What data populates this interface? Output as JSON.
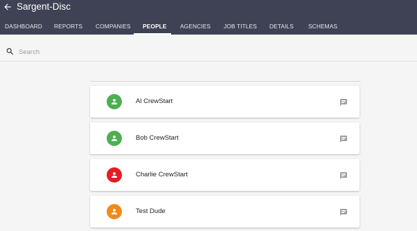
{
  "header": {
    "title": "Sargent-Disc",
    "background": "#3f4254"
  },
  "tabs": [
    {
      "label": "DASHBOARD",
      "active": false
    },
    {
      "label": "REPORTS",
      "active": false
    },
    {
      "label": "COMPANIES",
      "active": false
    },
    {
      "label": "PEOPLE",
      "active": true
    },
    {
      "label": "AGENCIES",
      "active": false
    },
    {
      "label": "JOB TITLES",
      "active": false
    },
    {
      "label": "DETAILS",
      "active": false
    },
    {
      "label": "SCHEMAS",
      "active": false
    }
  ],
  "search": {
    "placeholder": "Search",
    "value": ""
  },
  "people": [
    {
      "name": "Al CrewStart",
      "avatar_color": "#4caf50",
      "icon": "person-icon",
      "action_icon": "chat-icon"
    },
    {
      "name": "Bob CrewStart",
      "avatar_color": "#4caf50",
      "icon": "person-icon",
      "action_icon": "chat-icon"
    },
    {
      "name": "Charlie CrewStart",
      "avatar_color": "#e51c23",
      "icon": "person-icon",
      "action_icon": "chat-icon"
    },
    {
      "name": "Test Dude",
      "avatar_color": "#ef8a1c",
      "icon": "person-icon",
      "action_icon": "chat-icon"
    }
  ]
}
